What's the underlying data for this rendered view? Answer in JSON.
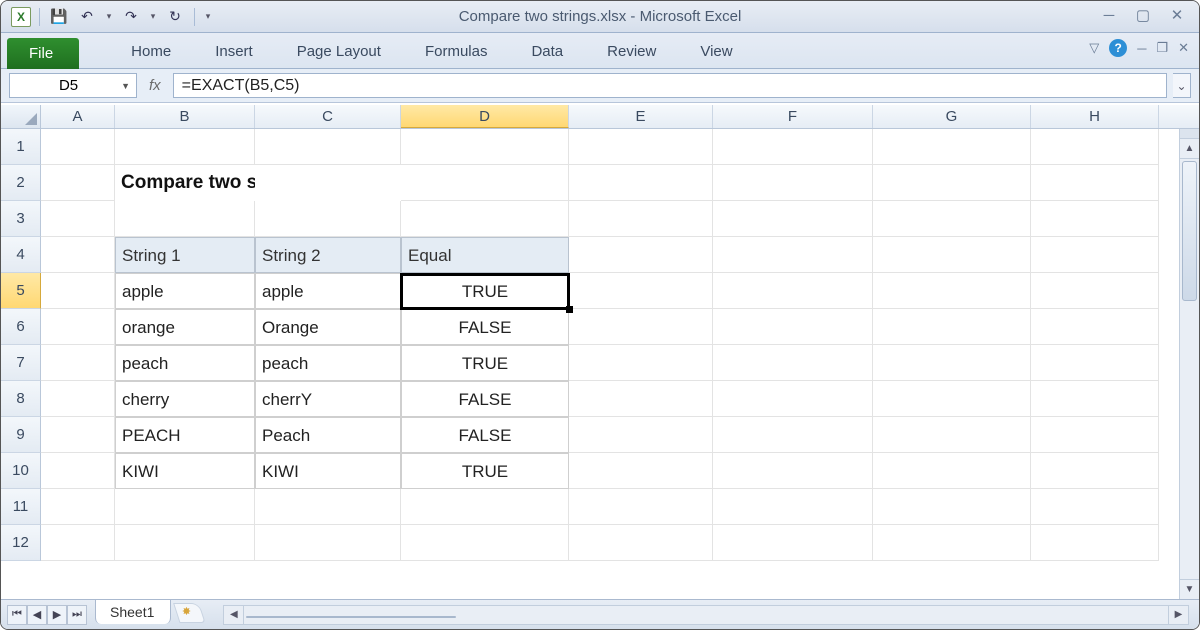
{
  "window": {
    "title": "Compare two strings.xlsx  -  Microsoft Excel"
  },
  "qat": {
    "app_letter": "X"
  },
  "ribbon": {
    "file": "File",
    "tabs": [
      "Home",
      "Insert",
      "Page Layout",
      "Formulas",
      "Data",
      "Review",
      "View"
    ]
  },
  "namebox": {
    "value": "D5"
  },
  "formula": {
    "fx": "fx",
    "value": "=EXACT(B5,C5)"
  },
  "columns": [
    "A",
    "B",
    "C",
    "D",
    "E",
    "F",
    "G",
    "H"
  ],
  "selected": {
    "col": "D",
    "row": 5
  },
  "content": {
    "title": "Compare two strings",
    "headers": {
      "b": "String 1",
      "c": "String 2",
      "d": "Equal"
    },
    "rows": [
      {
        "b": "apple",
        "c": "apple",
        "d": "TRUE"
      },
      {
        "b": "orange",
        "c": "Orange",
        "d": "FALSE"
      },
      {
        "b": "peach",
        "c": "peach",
        "d": "TRUE"
      },
      {
        "b": "cherry",
        "c": "cherrY",
        "d": "FALSE"
      },
      {
        "b": "PEACH",
        "c": "Peach",
        "d": "FALSE"
      },
      {
        "b": "KIWI",
        "c": "KIWI",
        "d": "TRUE"
      }
    ]
  },
  "sheet": {
    "name": "Sheet1"
  },
  "row_numbers": [
    "1",
    "2",
    "3",
    "4",
    "5",
    "6",
    "7",
    "8",
    "9",
    "10",
    "11",
    "12"
  ]
}
